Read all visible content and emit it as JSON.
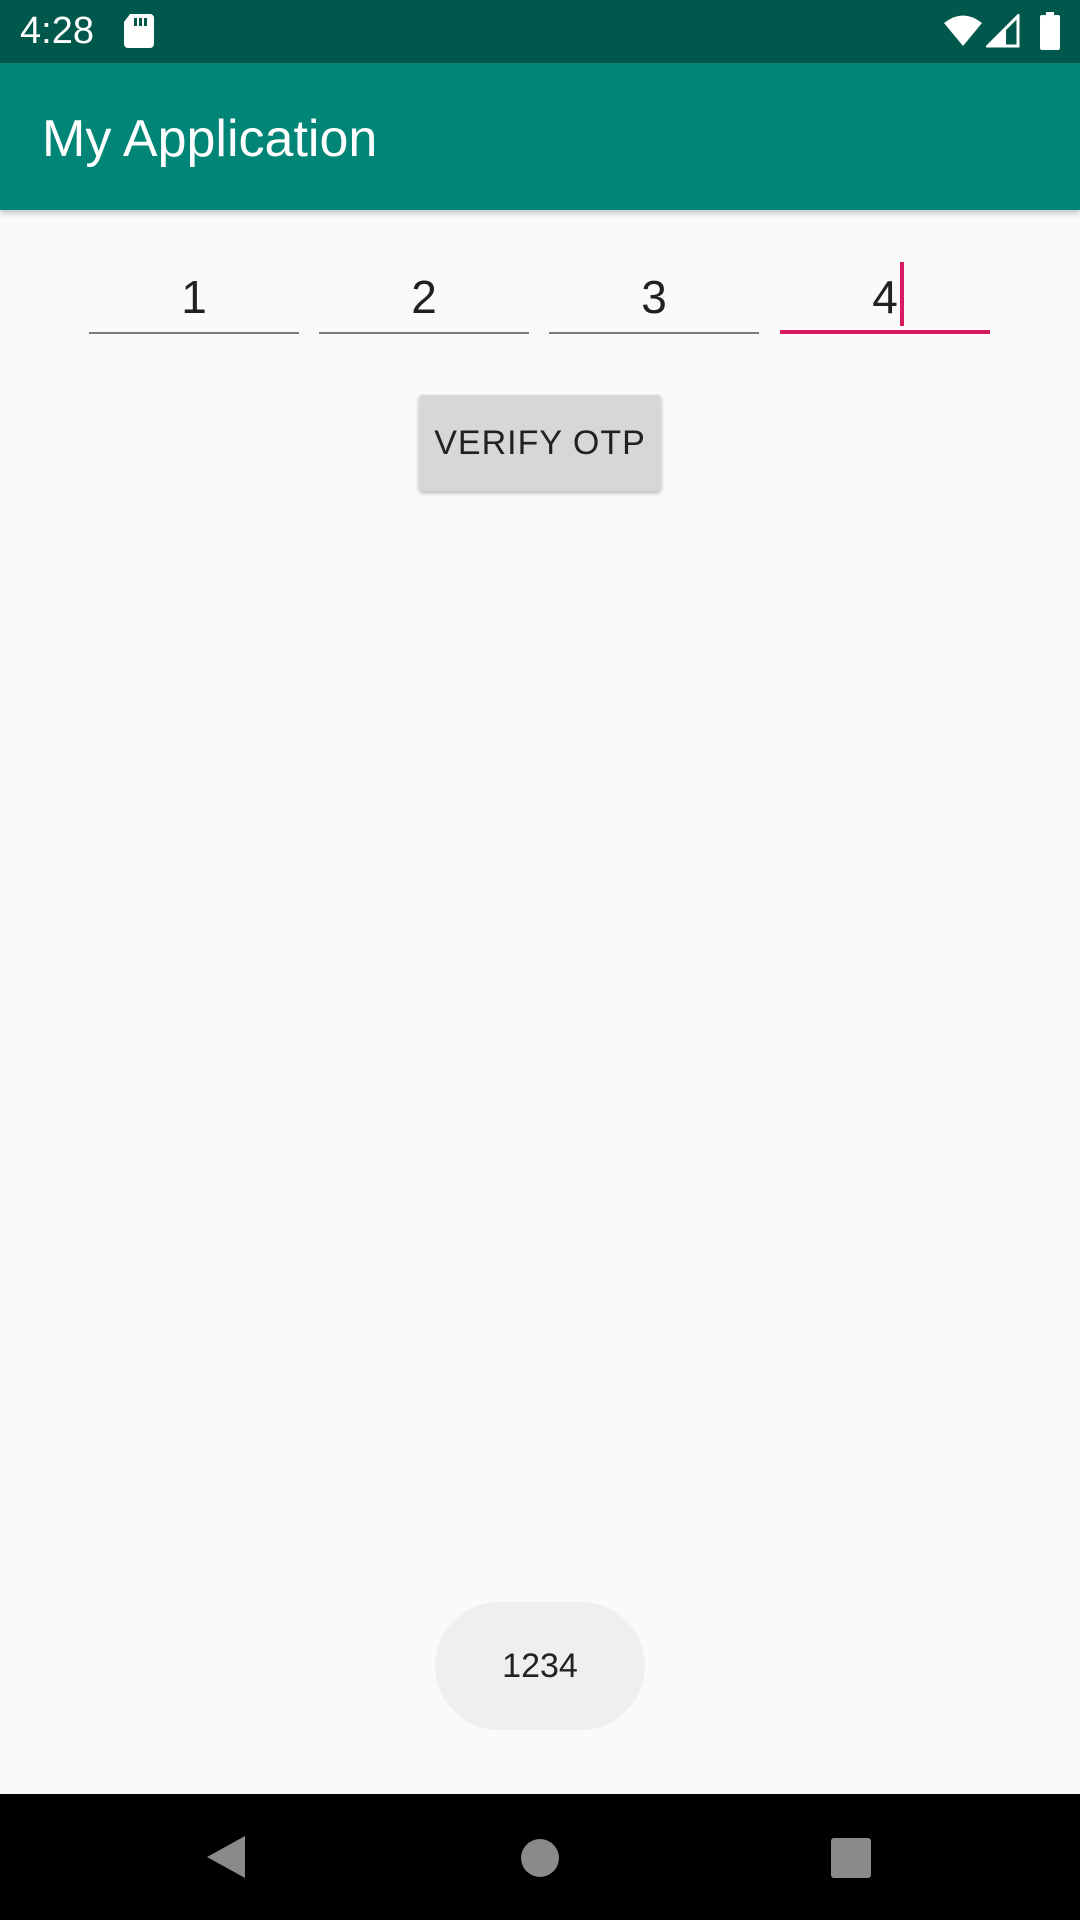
{
  "status_bar": {
    "time": "4:28",
    "icons": [
      "sd-card-icon",
      "wifi-icon",
      "cell-signal-icon",
      "battery-icon"
    ]
  },
  "app_bar": {
    "title": "My Application",
    "color": "#008577"
  },
  "otp": {
    "digits": [
      "1",
      "2",
      "3",
      "4"
    ],
    "focused_index": 3,
    "accent_color": "#d81b60"
  },
  "verify_button": {
    "label": "VERIFY OTP"
  },
  "toast": {
    "text": "1234"
  },
  "nav_bar": {
    "icons": [
      "back-icon",
      "home-icon",
      "recents-icon"
    ]
  }
}
